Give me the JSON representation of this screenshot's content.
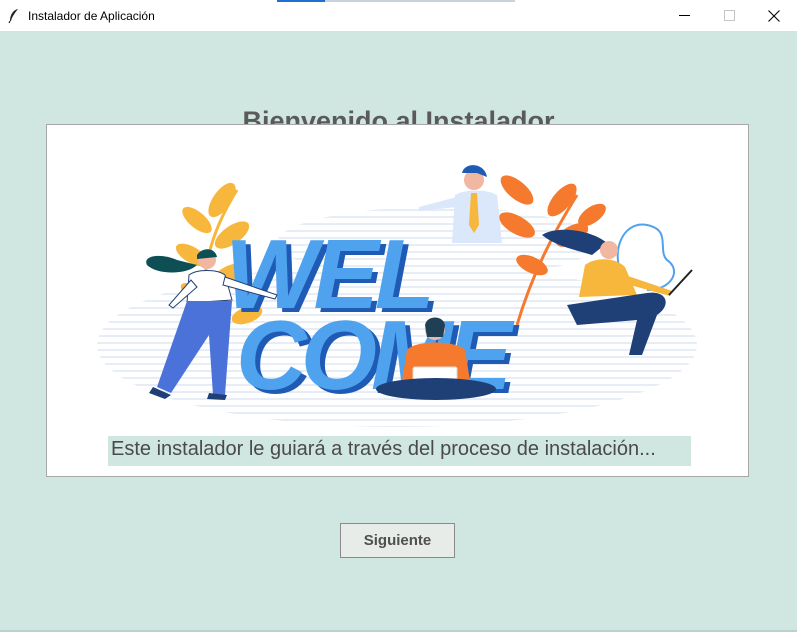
{
  "window": {
    "title": "Instalador de Aplicación",
    "icon": "feather-icon",
    "controls": [
      "minimize-icon",
      "maximize-icon",
      "close-icon"
    ]
  },
  "installer": {
    "heading": "Bienvenido al Instalador",
    "banner_text": {
      "line1": "WEL",
      "line2": "COME"
    },
    "subtitle": "Este instalador le guiará a través del proceso de instalación...",
    "next_button": "Siguiente"
  },
  "colors": {
    "background": "#cfe6e1",
    "panel": "#ffffff",
    "welcome_light": "#4fa3ee",
    "welcome_dark": "#1f5bb5",
    "leaf_yellow": "#f6b73c",
    "leaf_orange": "#f57a2e"
  }
}
